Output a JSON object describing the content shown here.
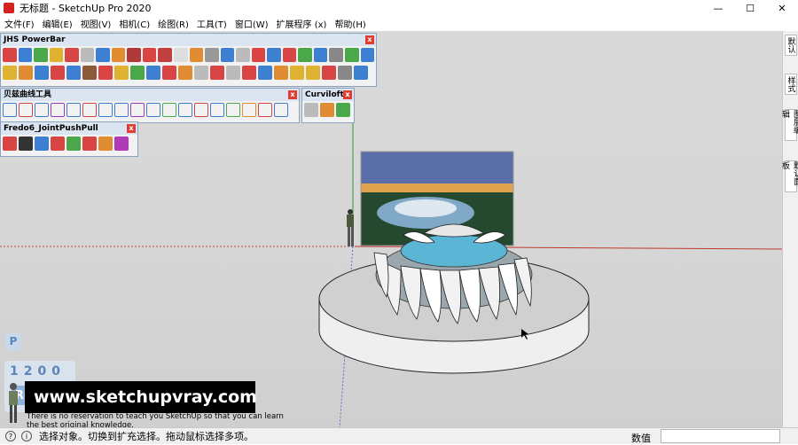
{
  "window": {
    "title": "无标题 - SketchUp Pro 2020",
    "minimize_glyph": "—",
    "maximize_glyph": "☐",
    "close_glyph": "✕"
  },
  "menu": [
    {
      "label": "文件(F)"
    },
    {
      "label": "编辑(E)"
    },
    {
      "label": "视图(V)"
    },
    {
      "label": "相机(C)"
    },
    {
      "label": "绘图(R)"
    },
    {
      "label": "工具(T)"
    },
    {
      "label": "窗口(W)"
    },
    {
      "label": "扩展程序 (x)"
    },
    {
      "label": "帮助(H)"
    }
  ],
  "toolbars": {
    "jhs": {
      "title": "JHS PowerBar",
      "close": "x"
    },
    "bezier": {
      "title": "贝兹曲线工具",
      "close": "x"
    },
    "curviloft": {
      "title": "Curviloft",
      "close": "x"
    },
    "fredo": {
      "title": "Fredo6_JointPushPull",
      "close": "x"
    }
  },
  "right_tray": [
    {
      "label": "默认"
    },
    {
      "label": "样式"
    },
    {
      "label": "图层编辑"
    },
    {
      "label": "默认面板"
    }
  ],
  "overlay": {
    "p_button": "P",
    "number_display": "1200",
    "return_button": "Return",
    "website": "www.sketchupvray.com",
    "subtitle": "There is no reservation to teach you SketchUp so that you can learn the best original knowledge."
  },
  "statusbar": {
    "text": "选择对象。切换到扩充选择。拖动鼠标选择多项。",
    "measure_label": "数值",
    "measure_value": ""
  },
  "colors": {
    "accent_red": "#e03c31",
    "toolbar_title_bg": "#dbe5f1",
    "return_button_bg": "#8fb3db",
    "sky_gray": "#d6d6d6",
    "ground_plane": "#dcdcdc"
  }
}
